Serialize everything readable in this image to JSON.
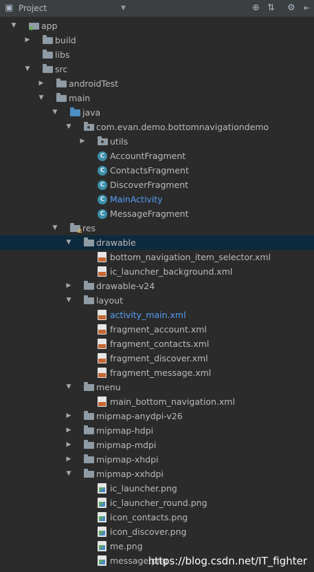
{
  "toolbar": {
    "title": "Project"
  },
  "tree": [
    {
      "label": "app",
      "indent": 0,
      "arrow": "down",
      "icon": "module"
    },
    {
      "label": "build",
      "indent": 1,
      "arrow": "right",
      "icon": "folder"
    },
    {
      "label": "libs",
      "indent": 1,
      "arrow": "none",
      "icon": "folder"
    },
    {
      "label": "src",
      "indent": 1,
      "arrow": "down",
      "icon": "folder"
    },
    {
      "label": "androidTest",
      "indent": 2,
      "arrow": "right",
      "icon": "folder"
    },
    {
      "label": "main",
      "indent": 2,
      "arrow": "down",
      "icon": "folder"
    },
    {
      "label": "java",
      "indent": 3,
      "arrow": "down",
      "icon": "folder-blue"
    },
    {
      "label": "com.evan.demo.bottomnavigationdemo",
      "indent": 4,
      "arrow": "down",
      "icon": "package"
    },
    {
      "label": "utils",
      "indent": 5,
      "arrow": "right",
      "icon": "package"
    },
    {
      "label": "AccountFragment",
      "indent": 5,
      "arrow": "none",
      "icon": "class"
    },
    {
      "label": "ContactsFragment",
      "indent": 5,
      "arrow": "none",
      "icon": "class"
    },
    {
      "label": "DiscoverFragment",
      "indent": 5,
      "arrow": "none",
      "icon": "class"
    },
    {
      "label": "MainActivity",
      "indent": 5,
      "arrow": "none",
      "icon": "class",
      "link": true
    },
    {
      "label": "MessageFragment",
      "indent": 5,
      "arrow": "none",
      "icon": "class"
    },
    {
      "label": "res",
      "indent": 3,
      "arrow": "down",
      "icon": "res"
    },
    {
      "label": "drawable",
      "indent": 4,
      "arrow": "down",
      "icon": "folder",
      "selected": true
    },
    {
      "label": "bottom_navigation_item_selector.xml",
      "indent": 5,
      "arrow": "none",
      "icon": "xml"
    },
    {
      "label": "ic_launcher_background.xml",
      "indent": 5,
      "arrow": "none",
      "icon": "xml"
    },
    {
      "label": "drawable-v24",
      "indent": 4,
      "arrow": "right",
      "icon": "folder"
    },
    {
      "label": "layout",
      "indent": 4,
      "arrow": "down",
      "icon": "folder"
    },
    {
      "label": "activity_main.xml",
      "indent": 5,
      "arrow": "none",
      "icon": "xml",
      "link": true
    },
    {
      "label": "fragment_account.xml",
      "indent": 5,
      "arrow": "none",
      "icon": "xml"
    },
    {
      "label": "fragment_contacts.xml",
      "indent": 5,
      "arrow": "none",
      "icon": "xml"
    },
    {
      "label": "fragment_discover.xml",
      "indent": 5,
      "arrow": "none",
      "icon": "xml"
    },
    {
      "label": "fragment_message.xml",
      "indent": 5,
      "arrow": "none",
      "icon": "xml"
    },
    {
      "label": "menu",
      "indent": 4,
      "arrow": "down",
      "icon": "folder"
    },
    {
      "label": "main_bottom_navigation.xml",
      "indent": 5,
      "arrow": "none",
      "icon": "xml"
    },
    {
      "label": "mipmap-anydpi-v26",
      "indent": 4,
      "arrow": "right",
      "icon": "folder"
    },
    {
      "label": "mipmap-hdpi",
      "indent": 4,
      "arrow": "right",
      "icon": "folder"
    },
    {
      "label": "mipmap-mdpi",
      "indent": 4,
      "arrow": "right",
      "icon": "folder"
    },
    {
      "label": "mipmap-xhdpi",
      "indent": 4,
      "arrow": "right",
      "icon": "folder"
    },
    {
      "label": "mipmap-xxhdpi",
      "indent": 4,
      "arrow": "down",
      "icon": "folder"
    },
    {
      "label": "ic_launcher.png",
      "indent": 5,
      "arrow": "none",
      "icon": "png"
    },
    {
      "label": "ic_launcher_round.png",
      "indent": 5,
      "arrow": "none",
      "icon": "png"
    },
    {
      "label": "icon_contacts.png",
      "indent": 5,
      "arrow": "none",
      "icon": "png"
    },
    {
      "label": "icon_discover.png",
      "indent": 5,
      "arrow": "none",
      "icon": "png"
    },
    {
      "label": "me.png",
      "indent": 5,
      "arrow": "none",
      "icon": "png"
    },
    {
      "label": "message.png",
      "indent": 5,
      "arrow": "none",
      "icon": "png"
    }
  ],
  "watermark": "https://blog.csdn.net/IT_fighter"
}
